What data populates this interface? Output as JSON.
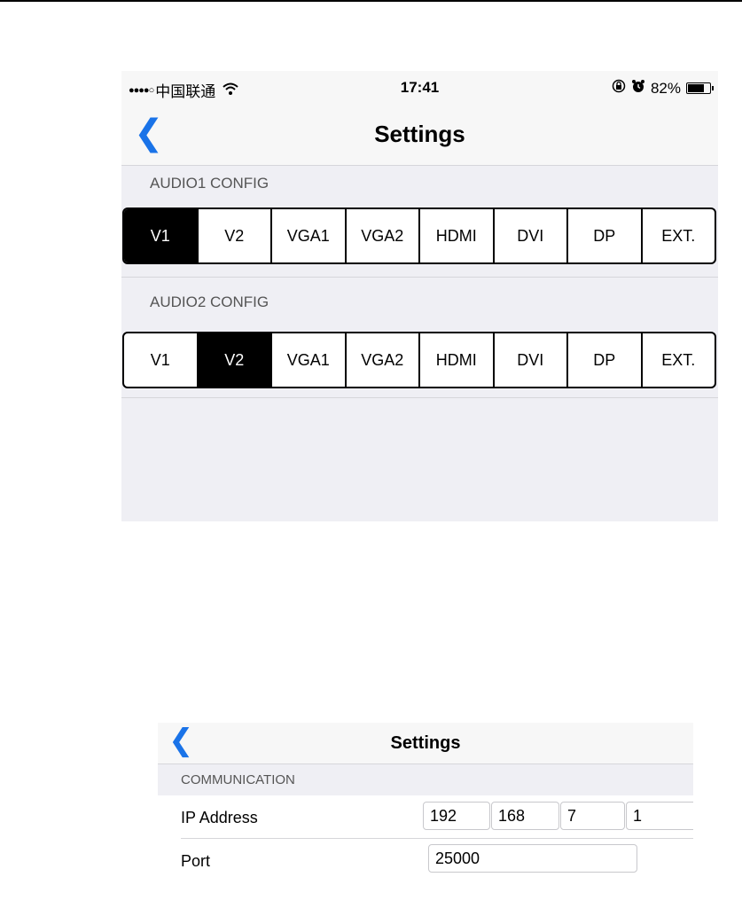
{
  "screen1": {
    "status": {
      "signal_dots": "●●●●○",
      "carrier": "中国联通",
      "wifi_icon": "wifi-icon",
      "time": "17:41",
      "lock_icon": "rotation-lock-icon",
      "alarm_icon": "alarm-icon",
      "battery_percent": "82%",
      "battery_level": 0.82
    },
    "nav": {
      "back_glyph": "❮",
      "title": "Settings"
    },
    "audio1": {
      "header": "AUDIO1 CONFIG",
      "options": [
        "V1",
        "V2",
        "VGA1",
        "VGA2",
        "HDMI",
        "DVI",
        "DP",
        "EXT."
      ],
      "selected": "V1"
    },
    "audio2": {
      "header": "AUDIO2 CONFIG",
      "options": [
        "V1",
        "V2",
        "VGA1",
        "VGA2",
        "HDMI",
        "DVI",
        "DP",
        "EXT."
      ],
      "selected": "V2"
    }
  },
  "screen2": {
    "nav": {
      "back_glyph": "❮",
      "title": "Settings"
    },
    "section": "COMMUNICATION",
    "ip": {
      "label": "IP Address",
      "octets": [
        "192",
        "168",
        "7",
        "1"
      ]
    },
    "port": {
      "label": "Port",
      "value": "25000"
    }
  },
  "colors": {
    "accent": "#1a73e8",
    "selected_segment": "#000000",
    "group_background": "#efeff4"
  }
}
